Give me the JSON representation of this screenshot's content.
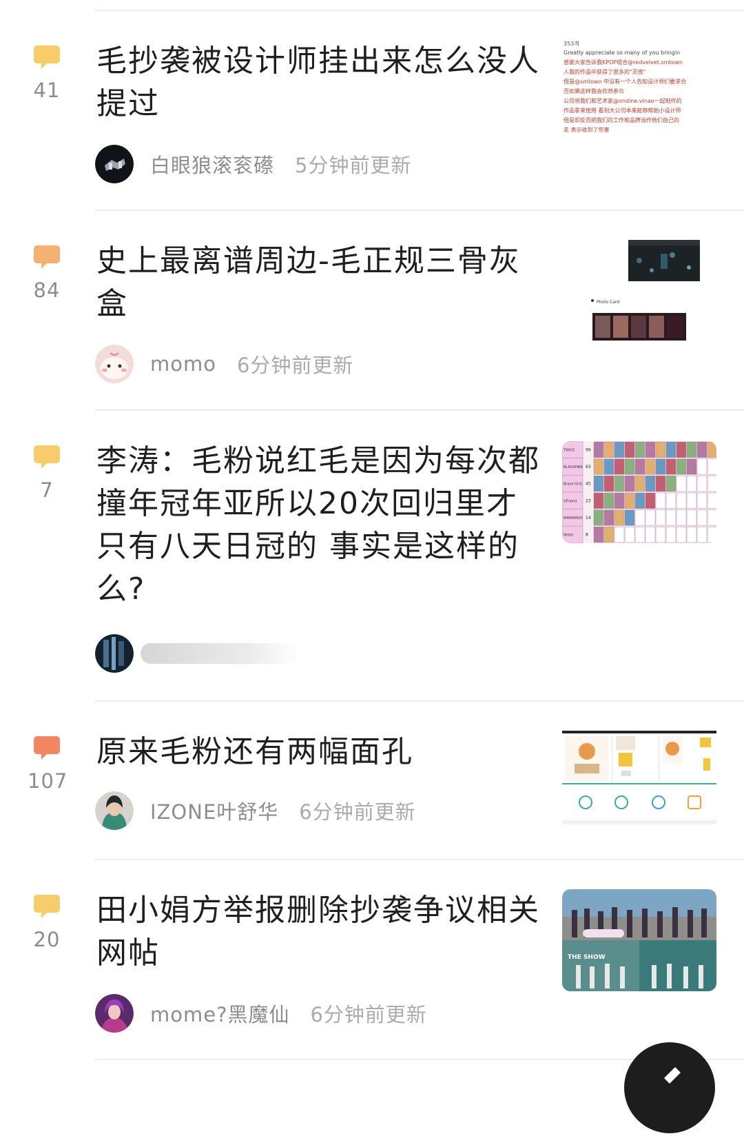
{
  "posts": [
    {
      "title": "毛抄袭被设计师挂出来怎么没人提过",
      "comments": "41",
      "author": "白眼狼滚衮礤",
      "time": "5分钟前更新",
      "bubble_color": "#f7cd6c",
      "thumb_text": [
        "Greatly appreciate so many of you bringin",
        "感谢大家告诉我KPOP组合@redvelvet.smtown",
        "人我的作品中获得了很多的\"灵感\"",
        "但是@smtown 中没有一个人告知设计师们要求合",
        "否如果这样我会欣然参与",
        "公司将我们和艺术家@ondine.vinao一起制作的",
        "作品拿来使用 看到大公司本来能够帮助小设计师",
        "但是却反而把我们的工作和品牌当作他们自己的",
        "走 表示收到了伤害"
      ],
      "thumb_header": "353개"
    },
    {
      "title": "史上最离谱周边-毛正规三骨灰盒",
      "comments": "84",
      "author": "momo",
      "time": "6分钟前更新",
      "bubble_color": "#f5b171",
      "thumb_label": "Photo Card"
    },
    {
      "title": "李涛：毛粉说红毛是因为每次都撞年冠年亚所以20次回归里才只有八天日冠的 事实是这样的么?",
      "comments": "7",
      "author": "",
      "time": "",
      "bubble_color": "#f7cd6c",
      "thumb_rows": [
        {
          "name": "TWICE",
          "num": "99"
        },
        {
          "name": "BLACKPINK",
          "num": "63"
        },
        {
          "name": "Brave Girls",
          "num": "45"
        },
        {
          "name": "GFriend",
          "num": "23"
        },
        {
          "name": "MAMAMOO",
          "num": "14"
        },
        {
          "name": "Rebel",
          "num": "8"
        }
      ]
    },
    {
      "title": "原来毛粉还有两幅面孔",
      "comments": "107",
      "author": "IZONE叶舒华",
      "time": "6分钟前更新",
      "bubble_color": "#f18663"
    },
    {
      "title": "田小娟方举报删除抄袭争议相关网帖",
      "comments": "20",
      "author": "mome?黑魔仙",
      "time": "6分钟前更新",
      "bubble_color": "#f7cd6c",
      "thumb_label": "THE SHOW"
    }
  ],
  "icons": {
    "comment": "comment-bubble-icon",
    "fab": "edit-pen-icon"
  }
}
